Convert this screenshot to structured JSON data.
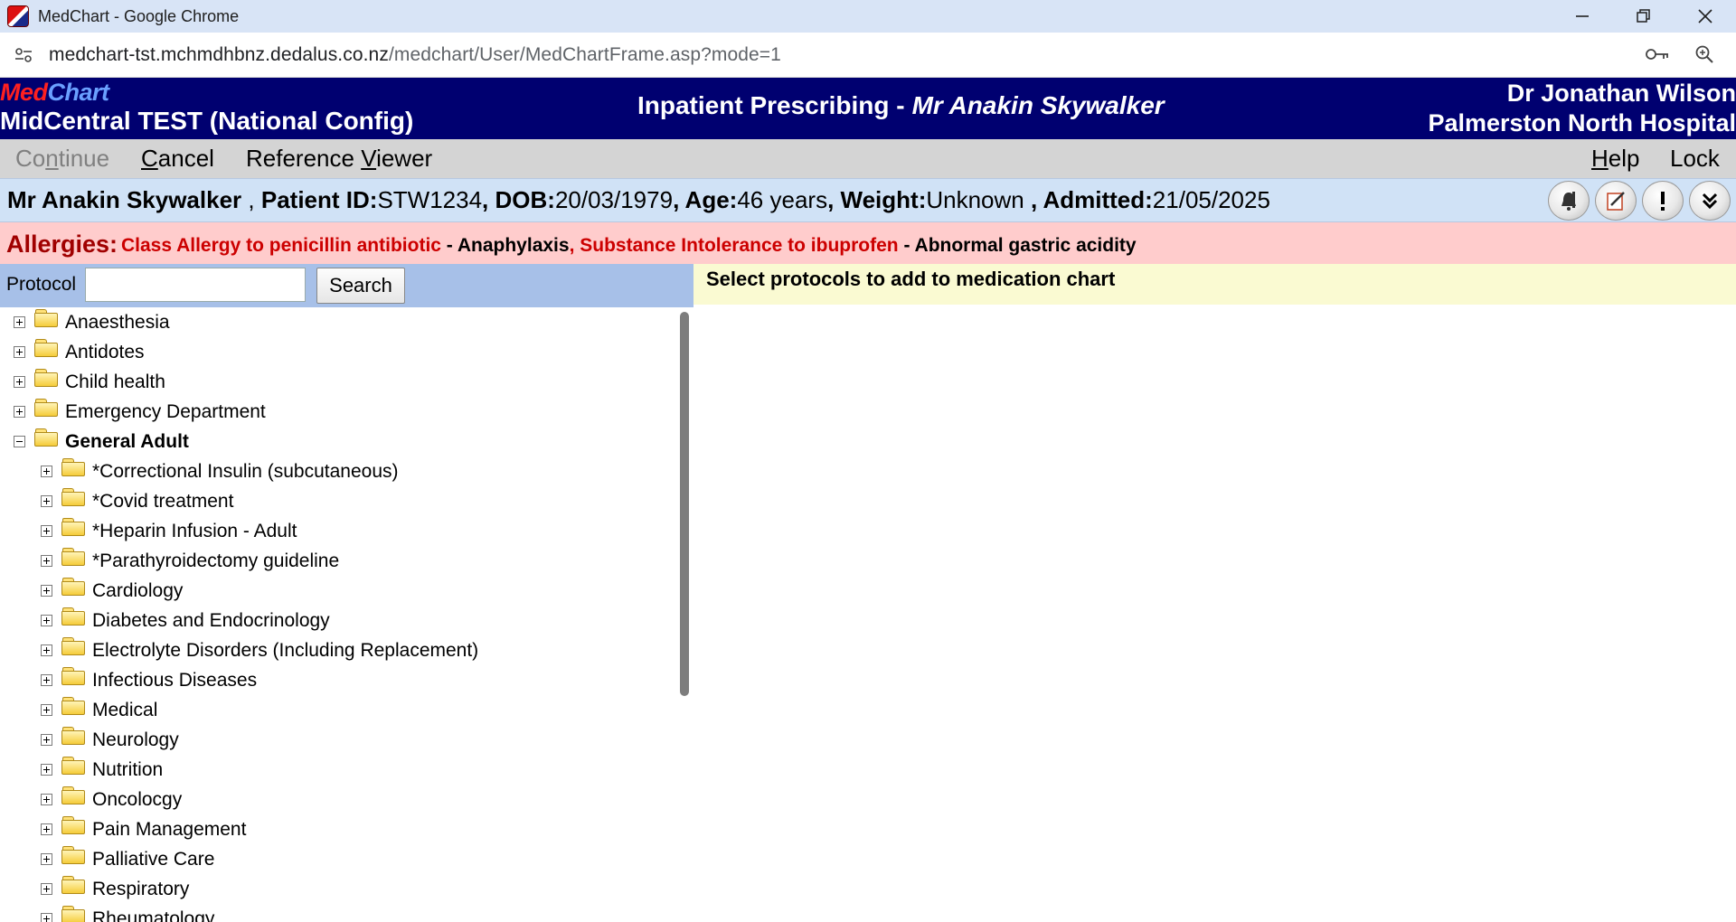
{
  "browser": {
    "window_title": "MedChart - Google Chrome",
    "url_host": "medchart-tst.mchmdhbnz.dedalus.co.nz",
    "url_path": "/medchart/User/MedChartFrame.asp?mode=1"
  },
  "header": {
    "logo_med": "Med",
    "logo_chart": "Chart",
    "organisation": "MidCentral TEST (National Config)",
    "module": "Inpatient Prescribing -",
    "patient_name": "Mr Anakin Skywalker",
    "user_name": "Dr Jonathan Wilson",
    "hospital": "Palmerston North Hospital"
  },
  "menu": {
    "continue_pre": "Co",
    "continue_ul": "n",
    "continue_post": "tinue",
    "cancel_ul": "C",
    "cancel_post": "ancel",
    "refviewer_pre": "Reference ",
    "refviewer_ul": "V",
    "refviewer_post": "iewer",
    "help_ul": "H",
    "help_post": "elp",
    "lock": "Lock"
  },
  "patient": {
    "name": "Mr Anakin Skywalker",
    "sep1": ",",
    "id_label": "Patient ID:",
    "id": "STW1234",
    "dob_label": ", DOB:",
    "dob": "20/03/1979",
    "age_label": ", Age:",
    "age": "46 years",
    "weight_label": ", Weight:",
    "weight": "Unknown",
    "admitted_label": " , Admitted:",
    "admitted": "21/05/2025"
  },
  "patient_icons": [
    "bell-icon",
    "edit-note-icon",
    "alert-icon",
    "expand-down-icon"
  ],
  "allergies": {
    "label": "Allergies:",
    "a1_substance": "Class Allergy to penicillin antibiotic",
    "a1_reaction": " - Anaphylaxis",
    "sep": ", ",
    "a2_substance": "Substance Intolerance to ibuprofen",
    "a2_reaction": " - Abnormal gastric acidity"
  },
  "search": {
    "label": "Protocol",
    "value": "",
    "button": "Search"
  },
  "tree": {
    "top_level": [
      {
        "label": "Anaesthesia",
        "expanded": false
      },
      {
        "label": "Antidotes",
        "expanded": false
      },
      {
        "label": "Child health",
        "expanded": false
      },
      {
        "label": "Emergency Department",
        "expanded": false
      },
      {
        "label": "General Adult",
        "expanded": true
      }
    ],
    "general_adult_children": [
      "*Correctional Insulin (subcutaneous)",
      "*Covid treatment",
      "*Heparin Infusion - Adult",
      "*Parathyroidectomy guideline",
      "Cardiology",
      "Diabetes and Endocrinology",
      "Electrolyte Disorders (Including Replacement)",
      "Infectious Diseases",
      "Medical",
      "Neurology",
      "Nutrition",
      "Oncolocgy",
      "Pain Management",
      "Palliative Care",
      "Respiratory",
      "Rheumatology"
    ]
  },
  "right_pane": {
    "title": "Select protocols to add to medication chart"
  },
  "colors": {
    "header_bg": "#000070",
    "allergy_bg": "#ffcccc",
    "allergy_text": "#cc0000",
    "patient_banner_bg": "#d0e2f6",
    "search_bar_bg": "#a7c0e8",
    "right_header_bg": "#fafad2"
  }
}
